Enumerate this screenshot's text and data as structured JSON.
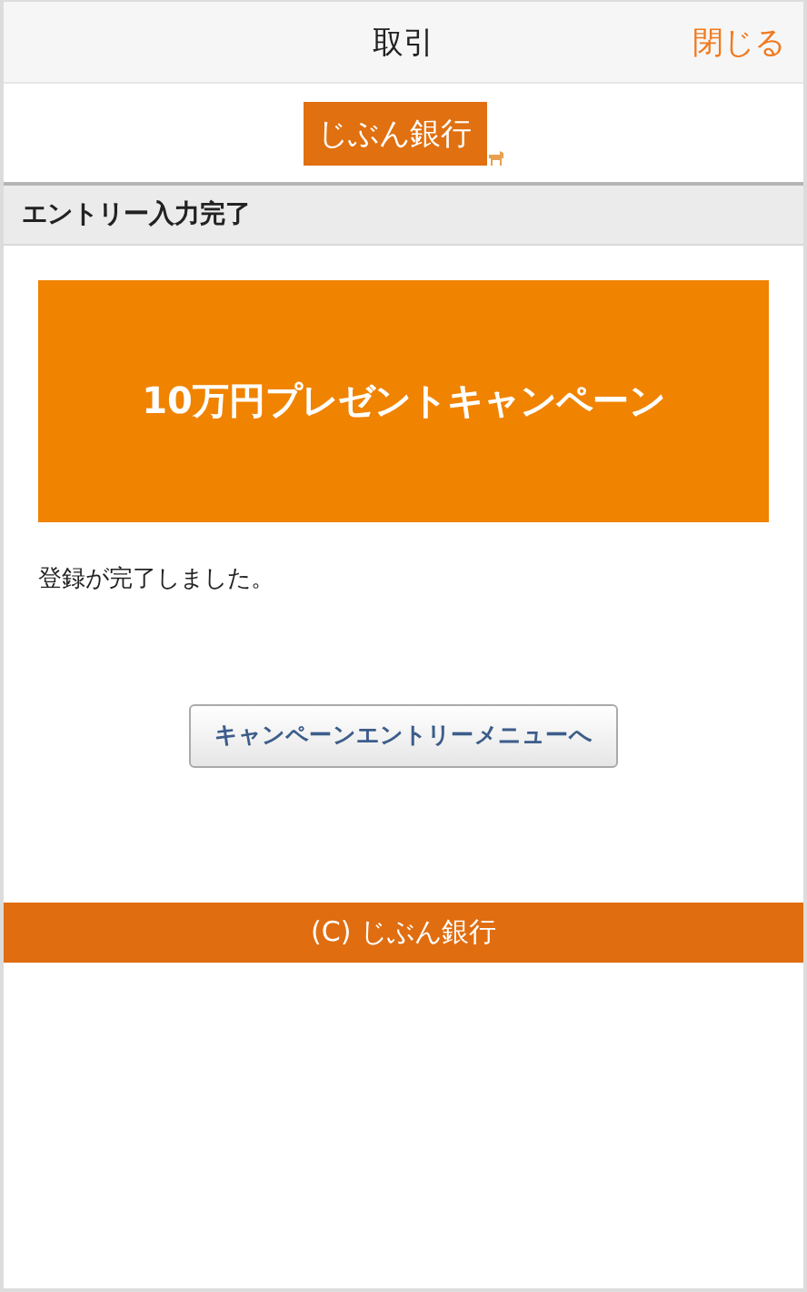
{
  "header": {
    "title": "取引",
    "close": "閉じる"
  },
  "logo": {
    "text": "じぶん銀行"
  },
  "section": {
    "title": "エントリー入力完了"
  },
  "banner": {
    "text": "10万円プレゼントキャンペーン"
  },
  "message": "登録が完了しました。",
  "button": {
    "label": "キャンペーンエントリーメニューへ"
  },
  "footer": {
    "text": "(C) じぶん銀行"
  }
}
